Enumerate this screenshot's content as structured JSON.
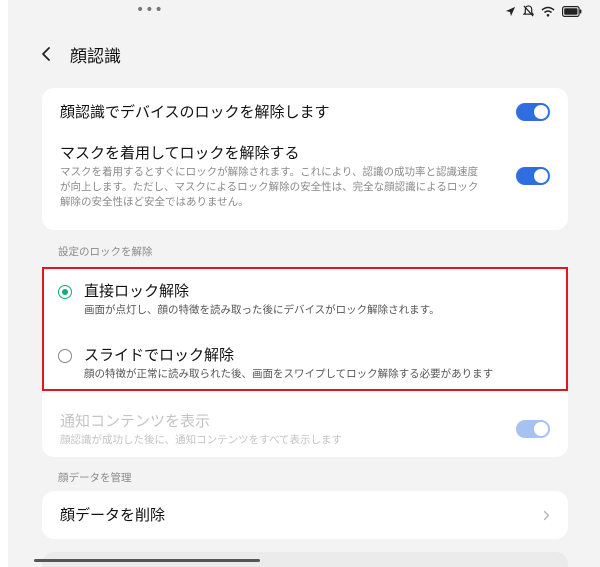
{
  "header": {
    "title": "顔認識"
  },
  "settings": {
    "face_unlock": {
      "title": "顔認識でデバイスのロックを解除します",
      "enabled": true
    },
    "mask_unlock": {
      "title": "マスクを着用してロックを解除する",
      "subtitle": "マスクを着用するとすぐにロックが解除されます。これにより、認識の成功率と認識速度が向上します。ただし、マスクによるロック解除の安全性は、完全な顔認識によるロック解除の安全性ほど安全ではありません。",
      "enabled": true
    }
  },
  "unlock_section": {
    "label": "設定のロックを解除",
    "options": [
      {
        "title": "直接ロック解除",
        "subtitle": "画面が点灯し、顔の特徴を読み取った後にデバイスがロック解除されます。",
        "checked": true
      },
      {
        "title": "スライドでロック解除",
        "subtitle": "顔の特徴が正常に読み取られた後、画面をスワイプしてロック解除する必要があります",
        "checked": false
      }
    ]
  },
  "notification": {
    "title": "通知コンテンツを表示",
    "subtitle": "顔認識が成功した後に、通知コンテンツをすべて表示します",
    "enabled": true,
    "disabled": true
  },
  "face_data_section": {
    "label": "顔データを管理",
    "delete_label": "顔データを削除"
  },
  "colors": {
    "accent": "#2f6de1",
    "radio": "#19a974",
    "highlight": "#e4151c"
  }
}
